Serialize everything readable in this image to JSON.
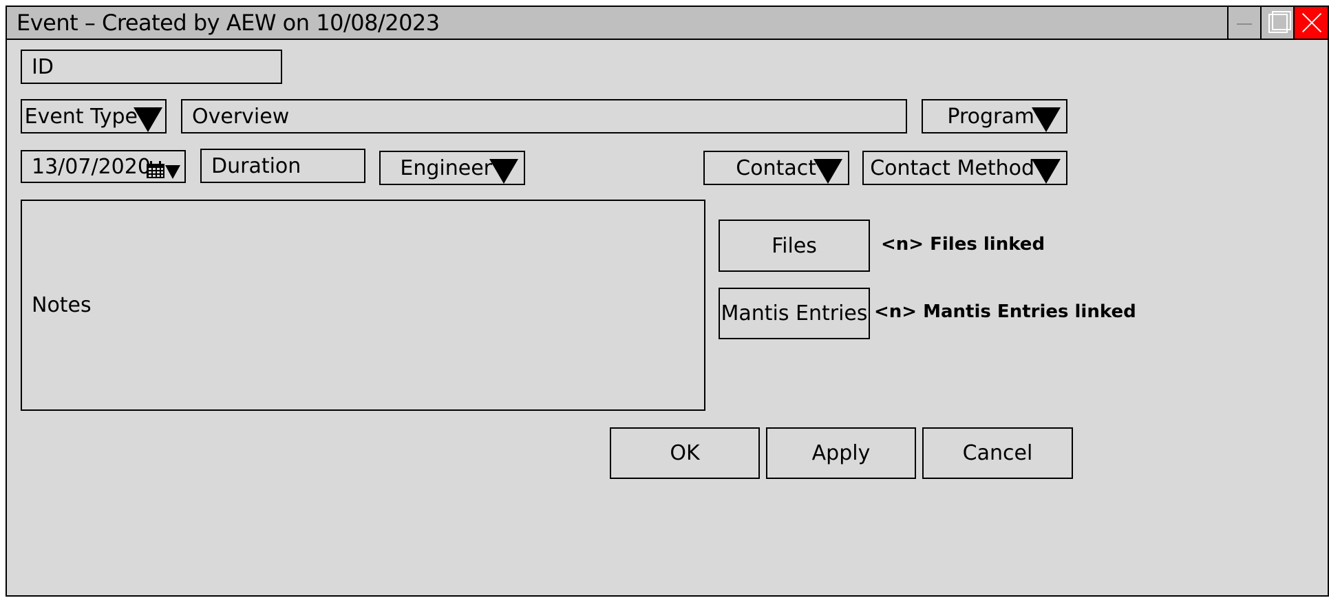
{
  "window": {
    "title": "Event – Created by AEW on 10/08/2023"
  },
  "fields": {
    "id_placeholder": "ID",
    "overview_placeholder": "Overview",
    "date_value": "13/07/2020",
    "duration_placeholder": "Duration",
    "notes_placeholder": "Notes"
  },
  "dropdowns": {
    "event_type": "Event Type",
    "program": "Program",
    "engineer": "Engineer",
    "contact": "Contact",
    "contact_method": "Contact Method"
  },
  "links": {
    "files_button": "Files",
    "files_status": "<n> Files linked",
    "mantis_button": "Mantis Entries",
    "mantis_status": "<n> Mantis Entries linked"
  },
  "footer": {
    "ok": "OK",
    "apply": "Apply",
    "cancel": "Cancel"
  },
  "icons": {
    "calendar": "calendar-icon",
    "dropdown": "triangle-down-icon",
    "close": "close-icon",
    "maximize": "maximize-icon",
    "minimize": "minimize-icon"
  },
  "colors": {
    "window_bg": "#d9d9d9",
    "titlebar_bg": "#bfbfbf",
    "close_bg": "#ff0000"
  }
}
